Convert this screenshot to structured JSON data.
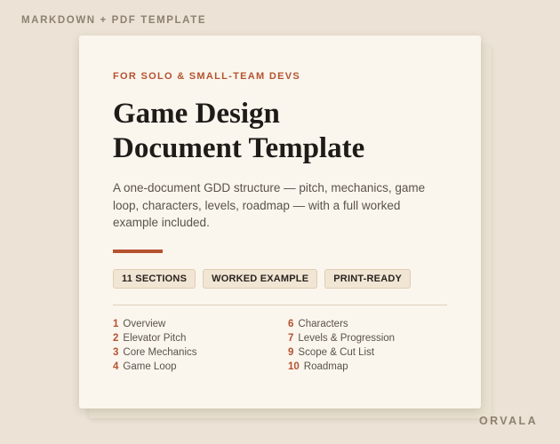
{
  "top_label": "MARKDOWN + PDF TEMPLATE",
  "brand": "ORVALA",
  "card": {
    "eyebrow": "FOR SOLO & SMALL-TEAM DEVS",
    "title_line1": "Game Design",
    "title_line2": "Document Template",
    "description": "A one-document GDD structure — pitch, mechanics, game loop, characters, levels, roadmap — with a full worked example included.",
    "badges": [
      "11 SECTIONS",
      "WORKED EXAMPLE",
      "PRINT-READY"
    ],
    "toc_left": [
      {
        "num": "1",
        "label": "Overview"
      },
      {
        "num": "2",
        "label": "Elevator Pitch"
      },
      {
        "num": "3",
        "label": "Core Mechanics"
      },
      {
        "num": "4",
        "label": "Game Loop"
      }
    ],
    "toc_right": [
      {
        "num": "6",
        "label": "Characters"
      },
      {
        "num": "7",
        "label": "Levels & Progression"
      },
      {
        "num": "9",
        "label": "Scope & Cut List"
      },
      {
        "num": "10",
        "label": "Roadmap"
      }
    ]
  },
  "colors": {
    "accent": "#b5522f",
    "background": "#ece3d6",
    "card": "#faf6ee"
  }
}
